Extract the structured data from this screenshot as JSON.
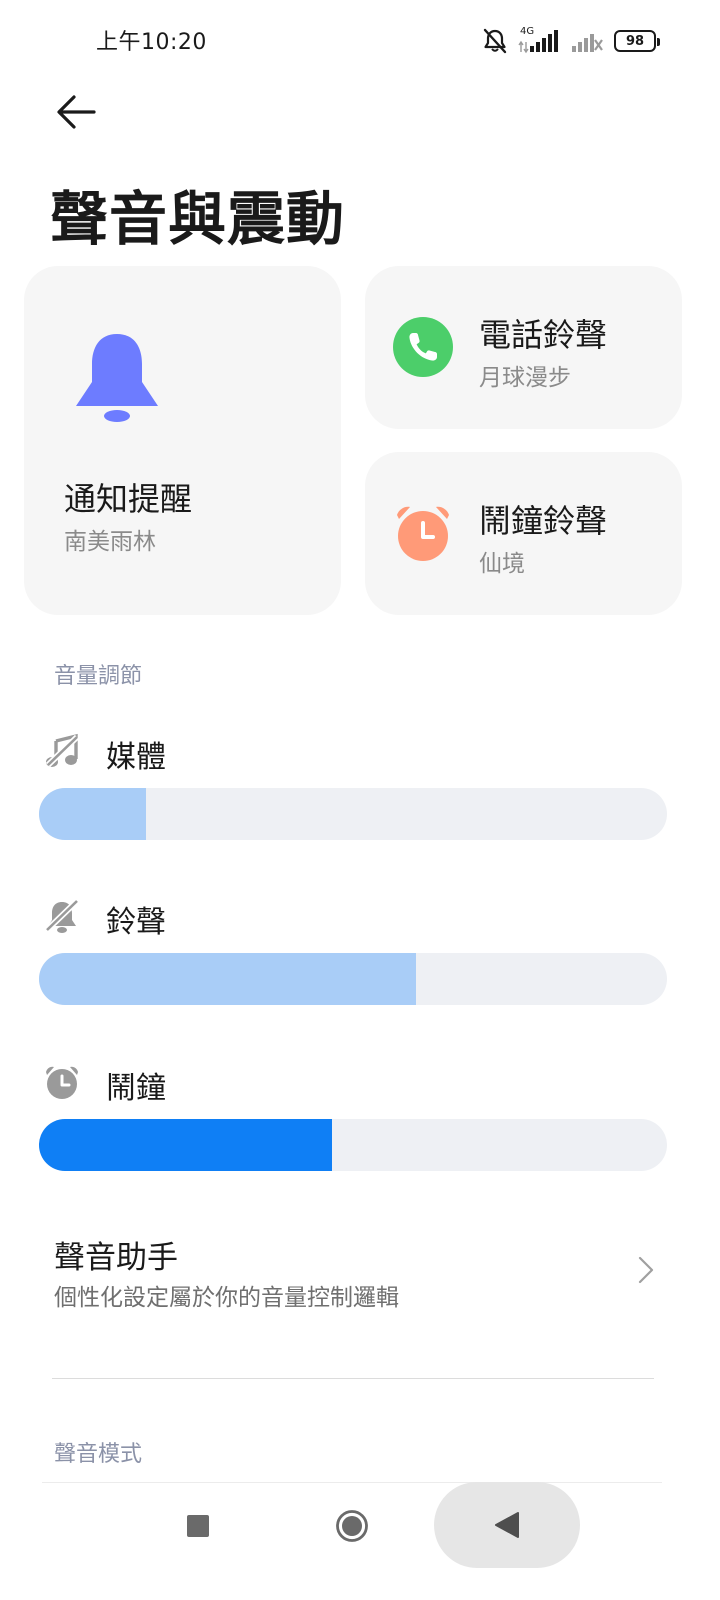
{
  "status_bar": {
    "time": "上午10:20",
    "network": "4G",
    "battery": "98"
  },
  "page": {
    "title": "聲音與震動"
  },
  "cards": {
    "notification": {
      "title": "通知提醒",
      "subtitle": "南美雨林",
      "icon": "bell-icon",
      "color": "#6d7cff"
    },
    "phone": {
      "title": "電話鈴聲",
      "subtitle": "月球漫步",
      "icon": "phone-icon",
      "color": "#4cce6a"
    },
    "alarm": {
      "title": "鬧鐘鈴聲",
      "subtitle": "仙境",
      "icon": "alarm-clock-icon",
      "color": "#ff9a78"
    }
  },
  "volume": {
    "section_label": "音量調節",
    "media": {
      "label": "媒體",
      "icon": "music-off-icon",
      "level": 0.17,
      "color": "#a9cdf7"
    },
    "ringtone": {
      "label": "鈴聲",
      "icon": "bell-off-icon",
      "level": 0.6,
      "color": "#a9cdf7"
    },
    "alarm": {
      "label": "鬧鐘",
      "icon": "alarm-icon",
      "level": 0.467,
      "color": "#0f7ff5"
    }
  },
  "assistant": {
    "title": "聲音助手",
    "subtitle": "個性化設定屬於你的音量控制邏輯"
  },
  "sound_mode": {
    "section_label": "聲音模式"
  }
}
